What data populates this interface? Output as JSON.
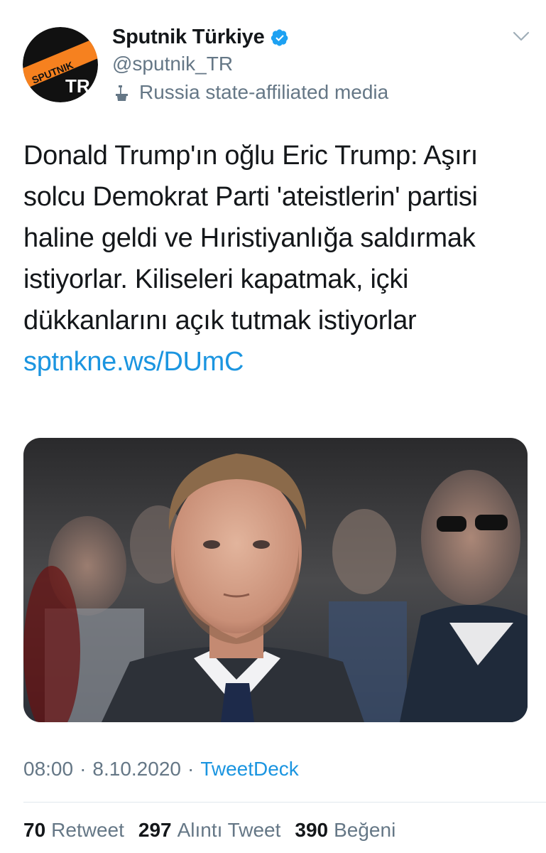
{
  "author": {
    "display_name": "Sputnik Türkiye",
    "handle": "@sputnik_TR",
    "label": "Russia state-affiliated media",
    "avatar_text_top": "SPUTNIK",
    "avatar_text_bottom": "TR"
  },
  "tweet": {
    "text": "Donald Trump'ın oğlu Eric Trump: Aşırı solcu Demokrat Parti 'ateistlerin' partisi haline geldi ve Hıristiyanlığa saldırmak istiyorlar. Kiliseleri kapatmak, içki dükkanlarını açık tutmak istiyorlar ",
    "link": "sptnkne.ws/DUmC"
  },
  "meta": {
    "time": "08:00",
    "dot1": "·",
    "date": "8.10.2020",
    "dot2": "·",
    "source": "TweetDeck"
  },
  "stats": {
    "retweets_count": "70",
    "retweets_label": "Retweet",
    "quotes_count": "297",
    "quotes_label": "Alıntı Tweet",
    "likes_count": "390",
    "likes_label": "Beğeni"
  },
  "colors": {
    "link": "#1b95e0",
    "secondary_text": "#657786",
    "avatar_orange": "#f6811f"
  },
  "icons": {
    "verified": "verified-badge-icon",
    "label": "state-media-podium-icon",
    "caret": "chevron-down-icon"
  }
}
